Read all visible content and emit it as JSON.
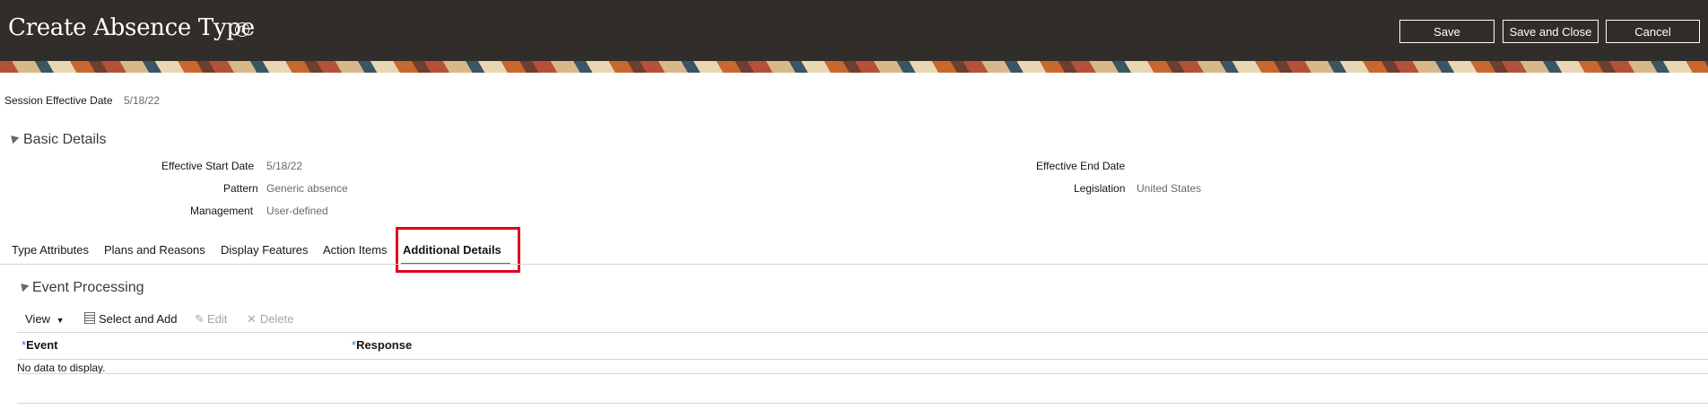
{
  "header": {
    "title": "Create Absence Type",
    "help_icon": "help-icon",
    "buttons": {
      "save": "Save",
      "save_and_close": "Save and Close",
      "cancel": "Cancel"
    }
  },
  "session": {
    "label": "Session Effective Date",
    "value": "5/18/22"
  },
  "basic_details": {
    "title": "Basic Details",
    "fields": {
      "effective_start_date": {
        "label": "Effective Start Date",
        "value": "5/18/22"
      },
      "pattern": {
        "label": "Pattern",
        "value": "Generic absence"
      },
      "management": {
        "label": "Management",
        "value": "User-defined"
      },
      "effective_end_date": {
        "label": "Effective End Date",
        "value": ""
      },
      "legislation": {
        "label": "Legislation",
        "value": "United States"
      }
    }
  },
  "tabs": [
    {
      "label": "Type Attributes"
    },
    {
      "label": "Plans and Reasons"
    },
    {
      "label": "Display Features"
    },
    {
      "label": "Action Items"
    },
    {
      "label": "Additional Details",
      "active": true
    }
  ],
  "event_processing": {
    "title": "Event Processing",
    "toolbar": {
      "view": "View",
      "select_and_add": "Select and Add",
      "edit": "Edit",
      "delete": "Delete"
    },
    "columns": {
      "required_marker": "*",
      "event": "Event",
      "response": "Response"
    },
    "empty_message": "No data to display."
  },
  "colors": {
    "header_bg": "#312d2a",
    "highlight": "#e0001b",
    "tab_underline": "#5c7a3a",
    "required": "#2d7ac9"
  }
}
